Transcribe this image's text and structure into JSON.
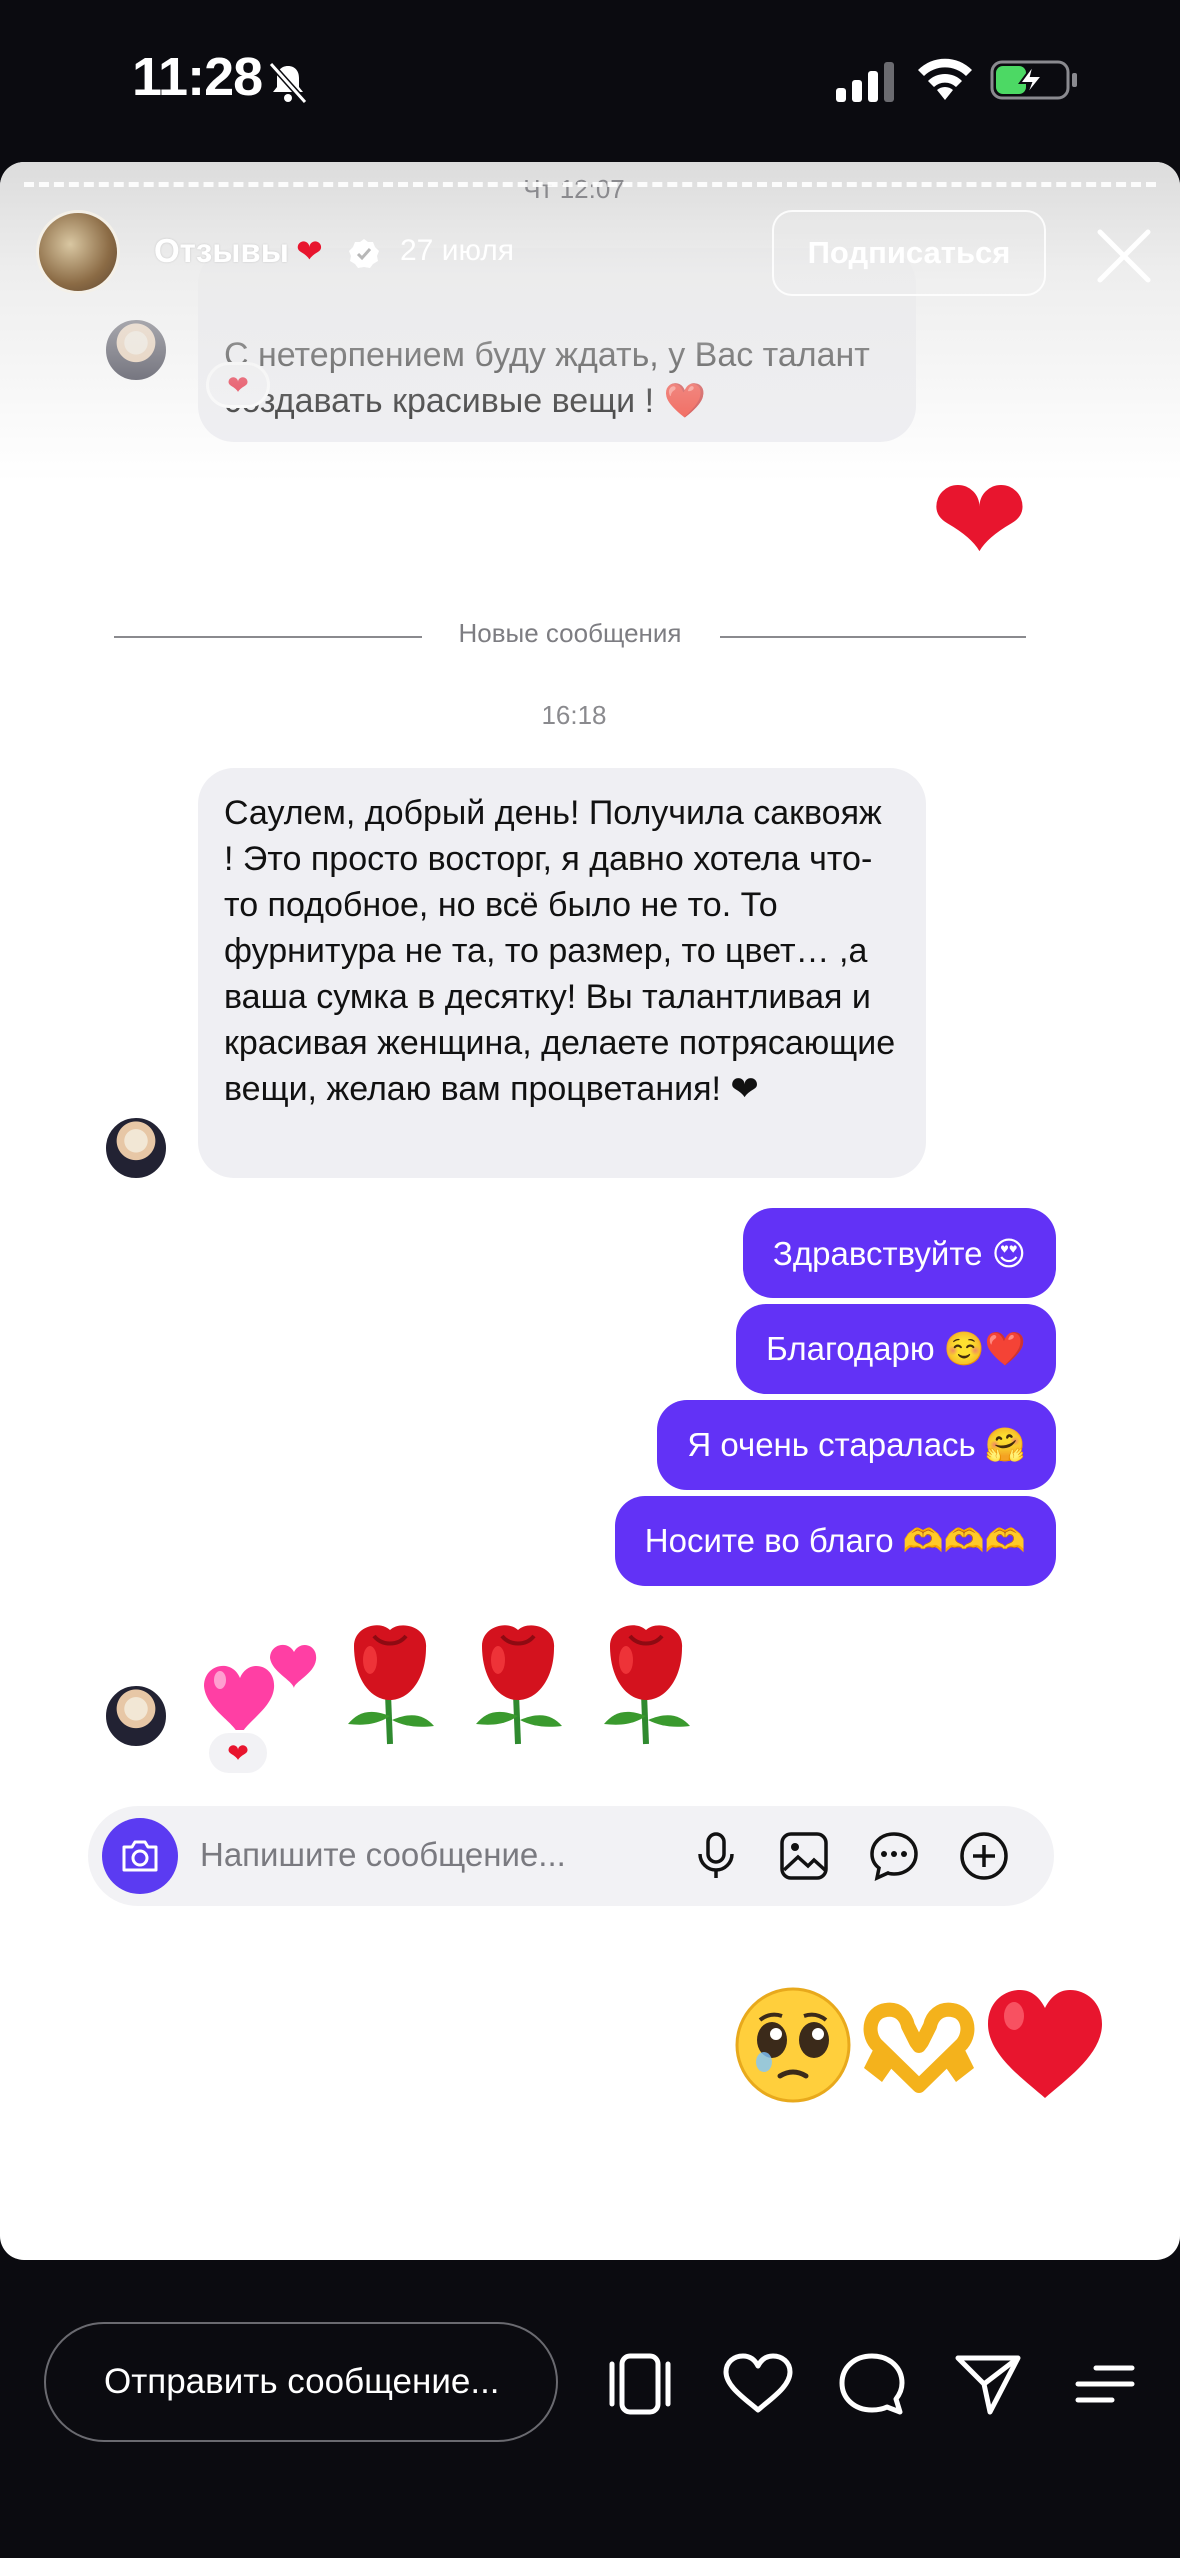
{
  "status_bar": {
    "time": "11:28"
  },
  "story": {
    "account_name": "Отзывы",
    "heart": "❤",
    "date": "27 июля",
    "follow_label": "Подписаться"
  },
  "chat": {
    "time_top": "Чт 12:07",
    "message_1": "С нетерпением буду ждать, у Вас талант создавать красивые вещи ! ❤️",
    "reaction": "❤",
    "big_heart": "❤",
    "new_messages_label": "Новые сообщения",
    "time_mid": "16:18",
    "message_2": "Саулем, добрый день! Получила саквояж ! Это просто восторг, я давно хотела что-то подобное, но всё было не то. То фурнитура не та, то размер, то цвет… ,а ваша сумка  в десятку! Вы талантливая и красивая женщина, делаете потрясающие вещи, желаю вам процветания! ❤",
    "outgoing": [
      "Здравствуйте 😍",
      "Благодарю ☺️❤️",
      "Я очень старалась 🤗",
      "Носите во благо 🫶🫶🫶"
    ],
    "composer_placeholder": "Напишите сообщение..."
  },
  "bottom_bar": {
    "reply_placeholder": "Отправить сообщение..."
  },
  "colors": {
    "accent": "#6232f6",
    "heart": "#e8152e",
    "background": "#0b0b10"
  }
}
